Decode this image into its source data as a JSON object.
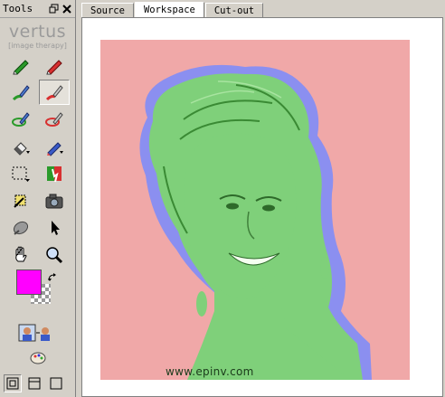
{
  "tools_panel": {
    "title": "Tools",
    "brand_name": "vertus",
    "brand_tagline": "[image therapy]"
  },
  "tabs": [
    {
      "label": "Source"
    },
    {
      "label": "Workspace"
    },
    {
      "label": "Cut-out"
    }
  ],
  "active_tab": "Workspace",
  "colors": {
    "foreground": "#ff00ff",
    "canvas_background": "#f0a8a8",
    "keep_mask": "#7fd07a",
    "remove_mask": "#8b8ff0"
  },
  "canvas": {
    "watermark": "www.epinv.com"
  }
}
